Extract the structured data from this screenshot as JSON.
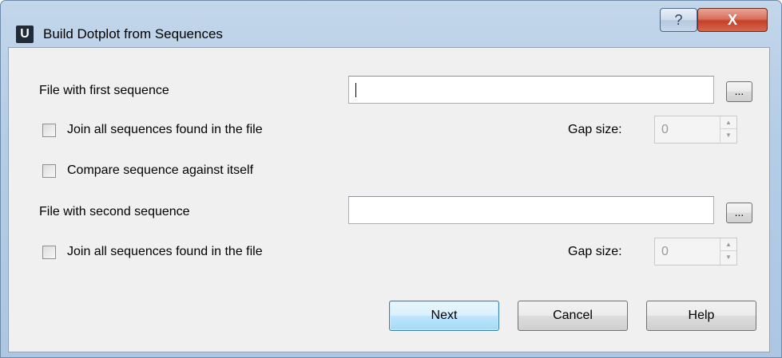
{
  "window": {
    "title": "Build Dotplot from Sequences",
    "app_icon_letter": "U",
    "help_glyph": "?",
    "close_glyph": "X"
  },
  "form": {
    "first_file_label": "File with first sequence",
    "first_file_value": "",
    "browse_label": "...",
    "join_first_label": "Join all sequences found in the file",
    "join_first_checked": false,
    "gap_label": "Gap size:",
    "gap_first_value": "0",
    "compare_self_label": "Compare sequence against itself",
    "compare_self_checked": false,
    "second_file_label": "File with second sequence",
    "second_file_value": "",
    "join_second_label": "Join all sequences found in the file",
    "join_second_checked": false,
    "gap_second_value": "0"
  },
  "buttons": {
    "next": "Next",
    "cancel": "Cancel",
    "help": "Help"
  },
  "icons": {
    "spin_up": "▲",
    "spin_down": "▼"
  },
  "colors": {
    "default_button_border": "#3c7fb1",
    "close_button": "#c5412a",
    "frame": "#b4cce6"
  }
}
